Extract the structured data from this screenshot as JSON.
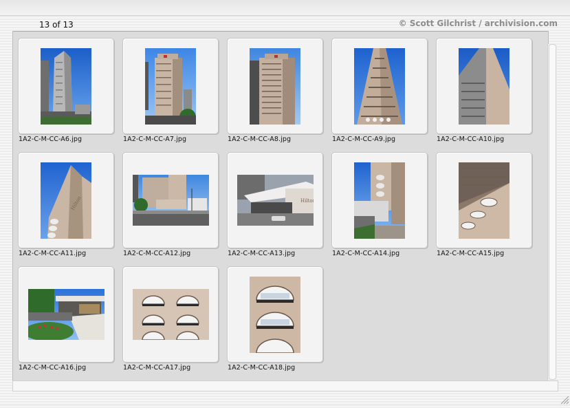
{
  "header": {
    "page_counter": "13 of 13",
    "credit": "© Scott Gilchrist / archivision.com"
  },
  "thumbnails": [
    {
      "filename": "1A2-C-M-CC-A6.jpg",
      "icon": "tower-photo-icon"
    },
    {
      "filename": "1A2-C-M-CC-A7.jpg",
      "icon": "tower-photo-icon"
    },
    {
      "filename": "1A2-C-M-CC-A8.jpg",
      "icon": "tower-photo-icon"
    },
    {
      "filename": "1A2-C-M-CC-A9.jpg",
      "icon": "tower-photo-icon"
    },
    {
      "filename": "1A2-C-M-CC-A10.jpg",
      "icon": "tower-photo-icon"
    },
    {
      "filename": "1A2-C-M-CC-A11.jpg",
      "icon": "tower-photo-icon"
    },
    {
      "filename": "1A2-C-M-CC-A12.jpg",
      "icon": "street-photo-icon"
    },
    {
      "filename": "1A2-C-M-CC-A13.jpg",
      "icon": "entrance-photo-icon"
    },
    {
      "filename": "1A2-C-M-CC-A14.jpg",
      "icon": "tower-photo-icon"
    },
    {
      "filename": "1A2-C-M-CC-A15.jpg",
      "icon": "balcony-photo-icon"
    },
    {
      "filename": "1A2-C-M-CC-A16.jpg",
      "icon": "plaza-photo-icon"
    },
    {
      "filename": "1A2-C-M-CC-A17.jpg",
      "icon": "facade-photo-icon"
    },
    {
      "filename": "1A2-C-M-CC-A18.jpg",
      "icon": "facade-photo-icon"
    }
  ],
  "colors": {
    "sky": "#2f7fe0",
    "concrete": "#c9b6a4",
    "panel": "#dcdcdc",
    "card": "#f3f3f3"
  }
}
